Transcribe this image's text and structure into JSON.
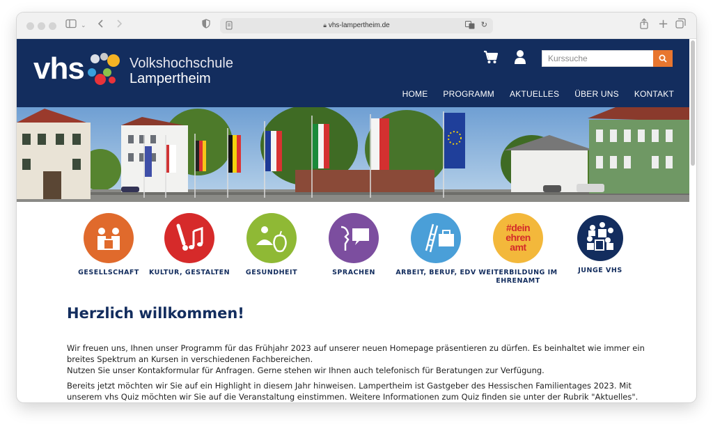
{
  "browser": {
    "url": "vhs-lampertheim.de"
  },
  "header": {
    "logo_mark": "vhs",
    "logo_line1": "Volkshochschule",
    "logo_line2": "Lampertheim",
    "search_placeholder": "Kurssuche",
    "nav": [
      "HOME",
      "PROGRAMM",
      "AKTUELLES",
      "ÜBER UNS",
      "KONTAKT"
    ]
  },
  "colors": {
    "header_bg": "#132d5e",
    "accent": "#e8762f"
  },
  "categories": [
    {
      "label": "GESELLSCHAFT",
      "color": "#e06a2c",
      "icon": "people-icon"
    },
    {
      "label": "KULTUR, GESTALTEN",
      "color": "#d62a2a",
      "icon": "music-brush-icon"
    },
    {
      "label": "GESUNDHEIT",
      "color": "#8fb935",
      "icon": "meditation-apple-icon"
    },
    {
      "label": "SPRACHEN",
      "color": "#7c4e9f",
      "icon": "speech-bubble-icon"
    },
    {
      "label": "ARBEIT, BERUF, EDV",
      "color": "#4a9fd8",
      "icon": "ladder-briefcase-icon"
    },
    {
      "label": "WEITERBILDUNG IM EHRENAMT",
      "color": "#f3b83b",
      "icon": "hashtag-ehrenamt-icon",
      "badge": [
        "#dein",
        "ehren",
        "amt"
      ]
    },
    {
      "label": "JUNGE VHS",
      "color": "#132d5e",
      "icon": "group-icon"
    }
  ],
  "main": {
    "title": "Herzlich willkommen!",
    "paragraphs": [
      "Wir freuen uns, Ihnen unser Programm für das Frühjahr 2023 auf unserer neuen Homepage präsentieren zu dürfen. Es beinhaltet wie immer ein breites Spektrum an Kursen in verschiedenen Fachbereichen.",
      "Nutzen Sie unser Kontakformular für Anfragen. Gerne stehen wir Ihnen auch telefonisch für Beratungen zur Verfügung.",
      "Bereits jetzt möchten wir Sie auf ein Highlight in diesem Jahr hinweisen. Lampertheim ist Gastgeber des Hessischen Familientages 2023. Mit unserem vhs Quiz möchten wir Sie auf die Veranstaltung einstimmen. Weitere Informationen zum Quiz finden sie unter der Rubrik \"Aktuelles\"."
    ]
  }
}
